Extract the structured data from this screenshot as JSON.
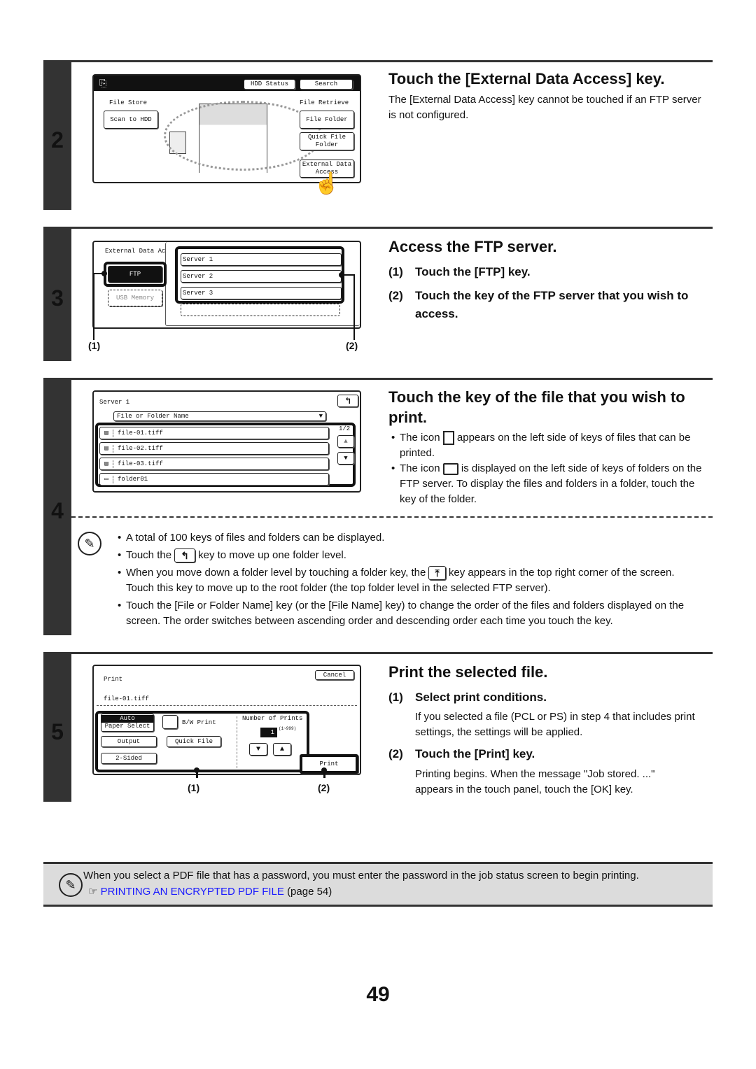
{
  "page_number": "49",
  "steps": [
    {
      "number": "2",
      "heading": "Touch the [External Data Access] key.",
      "body": "The [External Data Access] key cannot be touched if an FTP server is not configured.",
      "screen": {
        "header_buttons": [
          "HDD Status",
          "Search"
        ],
        "file_store_label": "File Store",
        "scan_to_hdd": "Scan to HDD",
        "file_retrieve_label": "File Retrieve",
        "file_folder": "File Folder",
        "quick_file_folder": "Quick File Folder",
        "external_data_access": "External Data Access"
      }
    },
    {
      "number": "3",
      "heading": "Access the FTP server.",
      "substeps": [
        {
          "num": "(1)",
          "text": "Touch the [FTP] key."
        },
        {
          "num": "(2)",
          "text": "Touch the key of the FTP server that you wish to access."
        }
      ],
      "screen": {
        "title": "External Data Ac",
        "ftp": "FTP",
        "usb_memory": "USB Memory",
        "servers": [
          "Server 1",
          "Server 2",
          "Server 3"
        ]
      },
      "callouts": [
        "(1)",
        "(2)"
      ]
    },
    {
      "number": "4",
      "heading": "Touch the key of the file that you wish to print.",
      "bullets": [
        {
          "before": "The icon",
          "after": "appears on the left side of keys of files that can be printed.",
          "icon": "printable-file-icon"
        },
        {
          "before": "The icon",
          "after": "is displayed on the left side of keys of folders on the FTP server. To display the files and folders in a folder, touch the key of the folder.",
          "icon": "folder-icon"
        }
      ],
      "screen": {
        "title": "Server 1",
        "sort_key": "File or Folder Name",
        "page": "1/2",
        "items": [
          {
            "type": "file",
            "name": "file-01.tiff"
          },
          {
            "type": "file",
            "name": "file-02.tiff"
          },
          {
            "type": "file",
            "name": "file-03.tiff"
          },
          {
            "type": "folder",
            "name": "folder01"
          }
        ]
      },
      "notes": {
        "n1": "A total of 100 keys of files and folders can be displayed.",
        "n2_before": "Touch the",
        "n2_after": "key to move up one folder level.",
        "n3_before": "When you move down a folder level by touching a folder key, the",
        "n3_after": "key appears in the top right corner of the screen. Touch this key to move up to the root folder (the top folder level in the selected FTP server).",
        "n4": "Touch the [File or Folder Name] key (or the [File Name] key) to change the order of the files and folders displayed on the screen. The order switches between ascending order and descending order each time you touch the key.",
        "up_key_glyph": "↰",
        "root_key_glyph": "⤒"
      }
    },
    {
      "number": "5",
      "heading": "Print the selected file.",
      "substeps": [
        {
          "num": "(1)",
          "text": "Select print conditions.",
          "body": "If you selected a file (PCL or PS) in step 4 that includes print settings, the settings will be applied."
        },
        {
          "num": "(2)",
          "text": "Touch the [Print] key.",
          "body": "Printing begins. When the message \"Job stored. ...\" appears in the touch panel, touch the [OK] key."
        }
      ],
      "screen": {
        "title": "Print",
        "cancel": "Cancel",
        "filename": "file-01.tiff",
        "paper_select_top": "Auto",
        "paper_select_bottom": "Paper Select",
        "bw_print": "B/W Print",
        "output": "Output",
        "quick_file": "Quick File",
        "two_sided": "2-Sided",
        "number_of_prints_label": "Number of Prints",
        "number_of_prints_value": "1",
        "range": "(1~999)",
        "print": "Print"
      },
      "callouts": [
        "(1)",
        "(2)"
      ]
    }
  ],
  "bottom_note": {
    "text": "When you select a PDF file that has a password, you must enter the password in the job status screen to begin printing.",
    "link_text": "PRINTING AN ENCRYPTED PDF FILE",
    "link_suffix": "(page 54)",
    "link_color": "#1a1aff"
  }
}
